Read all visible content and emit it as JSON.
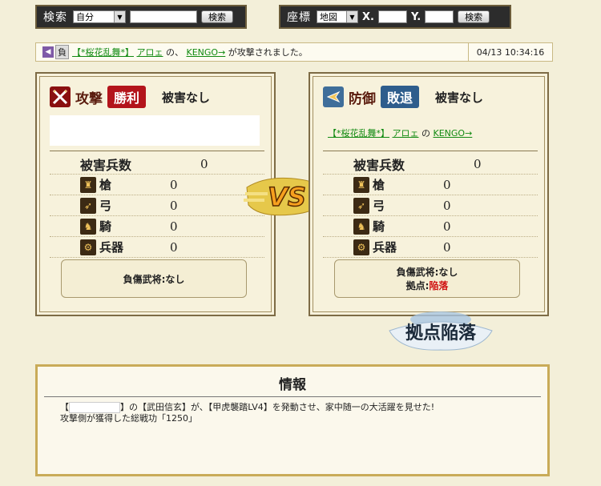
{
  "search_bar": {
    "label": "検索",
    "select_value": "自分",
    "input_value": "",
    "button_label": "検索"
  },
  "coord_bar": {
    "label": "座標",
    "select_value": "地図",
    "x_label": "X.",
    "y_label": "Y.",
    "x_value": "",
    "y_value": "",
    "button_label": "検索"
  },
  "notice": {
    "result": "負",
    "alliance": "【*桜花乱舞*】",
    "player1": "アロェ",
    "between": "の、",
    "player2": "KENGO→",
    "message": "が攻撃されました。",
    "time": "04/13 10:34:16"
  },
  "attack": {
    "title": "攻撃",
    "result": "勝利",
    "damage_status": "被害なし",
    "stats_header": "被害兵数",
    "stats_header_value": "0",
    "units": [
      {
        "icon": "spear-icon",
        "label": "槍",
        "value": "0"
      },
      {
        "icon": "bow-icon",
        "label": "弓",
        "value": "0"
      },
      {
        "icon": "horse-icon",
        "label": "騎",
        "value": "0"
      },
      {
        "icon": "weapon-icon",
        "label": "兵器",
        "value": "0"
      }
    ],
    "injury_label": "負傷武将:なし"
  },
  "defense": {
    "title": "防御",
    "result": "敗退",
    "damage_status": "被害なし",
    "alliance": "【*桜花乱舞*】",
    "player1": "アロェ",
    "between": "の",
    "player2": "KENGO→",
    "stats_header": "被害兵数",
    "stats_header_value": "0",
    "units": [
      {
        "icon": "spear-icon",
        "label": "槍",
        "value": "0"
      },
      {
        "icon": "bow-icon",
        "label": "弓",
        "value": "0"
      },
      {
        "icon": "horse-icon",
        "label": "騎",
        "value": "0"
      },
      {
        "icon": "weapon-icon",
        "label": "兵器",
        "value": "0"
      }
    ],
    "injury_label": "負傷武将:なし",
    "base_label": "拠点:",
    "base_status": "陥落"
  },
  "vs_text": "VS",
  "captured_text": "拠点陥落",
  "info": {
    "title": "情報",
    "line1_prefix": "【",
    "line1_rest": "】の【武田信玄】が、【甲虎襲踏LV4】を発動させ、家中随一の大活躍を見せた!",
    "line2": "攻撃側が獲得した総戦功「1250」"
  },
  "colors": {
    "win_badge": "#b3141b",
    "lose_badge": "#2e5d8c",
    "defeat_red": "#d01414",
    "link_green": "#118a11"
  }
}
